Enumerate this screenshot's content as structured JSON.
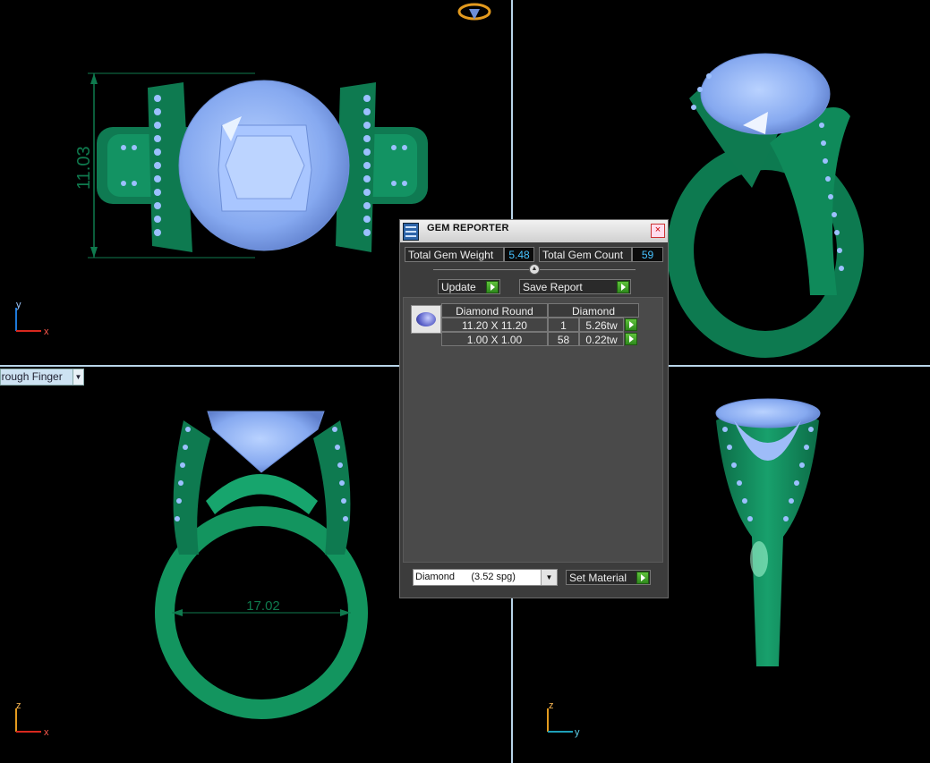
{
  "viewport": {
    "dimension_top": "11.03",
    "dimension_front": "17.02",
    "view_mode": "hrough Finger",
    "axes": {
      "top_left": {
        "v": "y",
        "h": "x"
      },
      "bottom_left": {
        "v": "z",
        "h": "x"
      },
      "bottom_right": {
        "v": "z",
        "h": "y"
      }
    }
  },
  "colors": {
    "ring_metal": "#128a5c",
    "gem_blue": "#8fb4f8",
    "separator": "#b8d4e8",
    "value_text": "#47c3ff"
  },
  "panel": {
    "title": "GEM REPORTER",
    "close": "×",
    "total_weight_label": "Total Gem Weight",
    "total_weight_value": "5.48",
    "total_count_label": "Total Gem Count",
    "total_count_value": "59",
    "update_label": "Update",
    "save_report_label": "Save Report",
    "table": {
      "headers": [
        "Diamond Round",
        "Diamond"
      ],
      "rows": [
        {
          "size": "11.20 X 11.20",
          "count": "1",
          "weight": "5.26tw"
        },
        {
          "size": "1.00 X 1.00",
          "count": "58",
          "weight": "0.22tw"
        }
      ]
    },
    "material_select": "Diamond      (3.52 spg)",
    "set_material_label": "Set Material"
  }
}
